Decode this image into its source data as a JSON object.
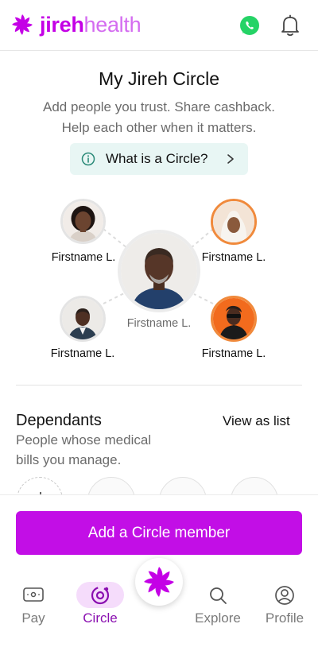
{
  "brand": {
    "name_part1": "jireh",
    "name_part2": "health",
    "color": "#c400e6"
  },
  "header": {
    "whatsapp_icon": "whatsapp-icon",
    "bell_icon": "bell-icon"
  },
  "intro": {
    "title": "My Jireh Circle",
    "subtitle_line1": "Add people you trust. Share cashback.",
    "subtitle_line2": "Help each other when it matters.",
    "info_pill": "What is a Circle?"
  },
  "circle": {
    "center": {
      "name": "Firstname L."
    },
    "members": [
      {
        "name": "Firstname L.",
        "position": "top-left"
      },
      {
        "name": "Firstname L.",
        "position": "top-right"
      },
      {
        "name": "Firstname L.",
        "position": "bottom-left"
      },
      {
        "name": "Firstname L.",
        "position": "bottom-right"
      }
    ]
  },
  "dependants": {
    "title": "Dependants",
    "subtitle_line1": "People whose medical",
    "subtitle_line2": "bills you manage.",
    "view_as_list": "View as list"
  },
  "cta": {
    "label": "Add a Circle member",
    "color": "#c20ee6"
  },
  "nav": {
    "items": [
      {
        "label": "Pay",
        "icon": "wallet-icon",
        "active": false
      },
      {
        "label": "Circle",
        "icon": "circle-icon",
        "active": true
      },
      {
        "label": "Explore",
        "icon": "search-icon",
        "active": false
      },
      {
        "label": "Profile",
        "icon": "user-icon",
        "active": false
      }
    ],
    "active_color": "#8a0fb0"
  }
}
